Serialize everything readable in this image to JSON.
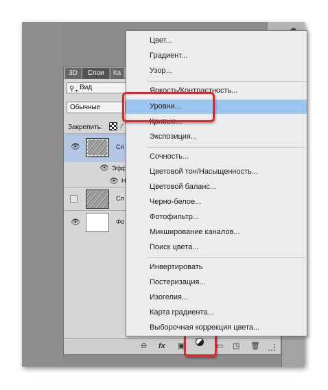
{
  "panel": {
    "tabs": [
      "3D",
      "Слои",
      "Ка"
    ],
    "search_label": "Вид",
    "blend_mode": "Обычные",
    "lock_label": "Закрепить:",
    "layers": [
      {
        "name": "Сл",
        "visible": true,
        "selected": true
      },
      {
        "name": "Эфф",
        "visible": true
      },
      {
        "name": "Н",
        "visible": true
      },
      {
        "name": "Сл",
        "visible": false
      },
      {
        "name": "Фо",
        "visible": true
      }
    ]
  },
  "bottom_icons": [
    "link-icon",
    "fx-icon",
    "mask-icon",
    "adjustment-icon",
    "folder-icon",
    "new-layer-icon",
    "trash-icon"
  ],
  "bottom_bar": {
    "fx_label": "fx"
  },
  "menu": {
    "items": [
      "Цвет...",
      "Градиент...",
      "Узор...",
      "Яркость/Контрастность...",
      "Уровни...",
      "Кривые...",
      "Экспозиция...",
      "Сочность...",
      "Цветовой тон/Насыщенность...",
      "Цветовой баланс...",
      "Черно-белое...",
      "Фотофильтр...",
      "Микширование каналов...",
      "Поиск цвета...",
      "Инвертировать",
      "Постеризация...",
      "Изогелия...",
      "Карта градиента...",
      "Выборочная коррекция цвета..."
    ],
    "highlighted": "Уровни..."
  },
  "colors": {
    "highlight": "#9bc6ef",
    "callout": "#e0232d"
  }
}
